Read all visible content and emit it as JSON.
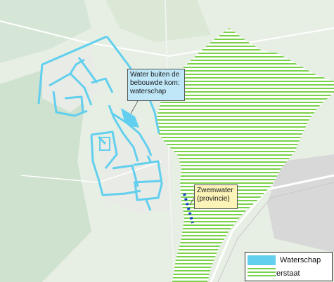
{
  "colors": {
    "map_background": "#e6eee4",
    "forest": "#cfe0cf",
    "urban": "#dcdcdc",
    "road": "#ffffff",
    "waterschap": "#62cfee",
    "rijkswaterstaat_stripe": "#7ad14a",
    "zwemwater": "#1040c8",
    "callout_water_bg": "#bfe7f7",
    "callout_swim_bg": "#fbf3b7"
  },
  "callouts": {
    "water_outside_builtup": "Water buiten de bebouwde kom: waterschap",
    "swim_water": "Zwemwater (provincie)"
  },
  "legend": {
    "items": [
      {
        "label": "Waterschap",
        "color": "#62cfee",
        "pattern": "solid"
      },
      {
        "label": "Rijkswaterstaat",
        "color": "#7ad14a",
        "pattern": "horizontal-stripes"
      }
    ]
  }
}
